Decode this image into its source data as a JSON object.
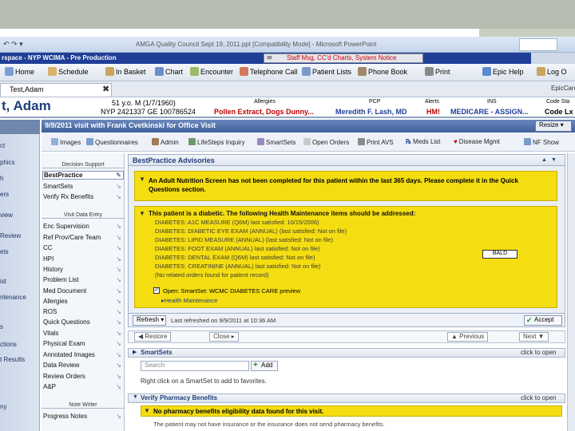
{
  "ppt": {
    "title": "AMGA Quality Council Sept 19, 2011.ppt [Compatibility Mode] - Microsoft PowerPoint",
    "icons": "↶ ↷ ▾"
  },
  "epic": {
    "title": "rspace - NYP WCIMA - Pre Production",
    "message": "Staff Msg, CC'd Charts, System Notice",
    "message_icon": "✉"
  },
  "toolbar": {
    "home": "Home",
    "schedule": "Schedule",
    "in_basket": "In Basket",
    "chart": "Chart",
    "encounter": "Encounter",
    "telephone_call": "Telephone Call",
    "patient_lists": "Patient Lists",
    "phone_book": "Phone Book",
    "print": "Print",
    "epic_help": "Epic Help",
    "log_out": "Log O"
  },
  "patient_tab": {
    "label": "Test,Adam",
    "close": "✖"
  },
  "epic_care": "EpicCare",
  "header": {
    "name": "t, Adam",
    "demo_line1": "51 y.o. M (1/7/1960)",
    "demo_line2": "NYP 2421337 GE 100786524",
    "allergies_label": "Allergies",
    "allergies_value": "Pollen Extract, Dogs Dunny...",
    "pcp_label": "PCP",
    "pcp_value": "Meredith F. Lash, MD",
    "alerts_label": "Alerts",
    "alerts_value": "HM!",
    "ins_label": "INS",
    "ins_value": "MEDICARE - ASSIGN...",
    "code_label": "Code Sta",
    "code_value": "Code Lx"
  },
  "leftnav": {
    "items": [
      "ct",
      "phics",
      "h",
      "ers",
      "view",
      "Review",
      "ets",
      "ist",
      "ntenance",
      "s",
      "ctions",
      "t Results",
      "ny"
    ]
  },
  "visit": {
    "title": "9/9/2011 visit with Frank Cvetkinski for Office Visit",
    "resize": "Resize ▾"
  },
  "visit_toolbar": {
    "images": "Images",
    "questionnaires": "Questionnaires",
    "admin": "Admin",
    "lifesteps_inquiry": "LifeSteps Inquiry",
    "smartsets": "SmartSets",
    "open_orders": "Open Orders",
    "print_avs": "Print AVS",
    "med_list": "Meds List",
    "disease_mgmt": "Disease Mgmt",
    "nf_show": "NF Show"
  },
  "activity": {
    "sec_decision": "Decision Support",
    "decision": [
      "BestPractice",
      "SmartSets",
      "Verify Rx Benefits"
    ],
    "sec_visit": "Visit Data Entry",
    "visit": [
      "Enc Supervision",
      "Ref Prov/Care Team",
      "CC",
      "HPI",
      "History",
      "Problem List",
      "Med Document",
      "Allergies",
      "ROS",
      "Quick Questions",
      "Vitals",
      "Physical Exam",
      "Annotated Images",
      "Data Review",
      "Review Orders",
      "A&P"
    ],
    "sec_note": "Note Writer",
    "note": [
      "Progress Notes"
    ]
  },
  "bpa": {
    "title": "BestPractice Advisories",
    "adv1_icon": "▼",
    "adv1_text": "An Adult Nutrition Screen has not been completed for this patient within the last 365 days. Please complete it in the Quick Questions section.",
    "adv2_icon": "▼",
    "adv2_head": "This patient is a diabetic. The following Health Maintenance items should be addressed:",
    "hm_items": [
      "DIABETES: A1C MEASURE (Q6M) last satisfied: 10/15/2006)",
      "DIABETES: DIABETIC EYE EXAM (ANNUAL) (last satisfied: Not on file)",
      "DIABETES: LIPID MEASURE (ANNUAL) (last satisfied: Not on file)",
      "DIABETES: FOOT EXAM (ANNUAL) last satisfied: Not on file)",
      "DIABETES: DENTAL EXAM (Q6M) last satisfied: Not on file)",
      "DIABETES: CREATININE (ANNUAL) last satisfied: Not on file)",
      "(No related orders found for patient record)"
    ],
    "bald_btn": "BALD",
    "open_text": "Open: SmartSet: WCMC DIABETES CARE preview",
    "checkbox": "✓",
    "hm_link": "▸Health Maintenance",
    "refresh": "Refresh ▾",
    "refreshed": "Last refreshed on 9/9/2011 at 10:36 AM",
    "accept": "Accept",
    "accept_icon": "✔",
    "restore": "◀ Restore",
    "close": "Close ▸",
    "previous": "▲ Previous",
    "next": "Next ▼"
  },
  "smartsets": {
    "title": "SmartSets",
    "open": "click to open",
    "search_placeholder": "Search",
    "add": "Add",
    "hint": "Right click on a SmartSet to add to favorites."
  },
  "pharmacy": {
    "title": "Verify Pharmacy Benefits",
    "open": "click to open",
    "warn": "No pharmacy benefits eligibility data found for this visit.",
    "note": "The patient may not have insurance or the insurance does not send pharmacy benefits."
  },
  "colors": {
    "epic_blue": "#1f3f97",
    "advisory_yellow": "#f4dd11",
    "link_blue": "#1f3f7a",
    "alert_red": "#c00000"
  }
}
